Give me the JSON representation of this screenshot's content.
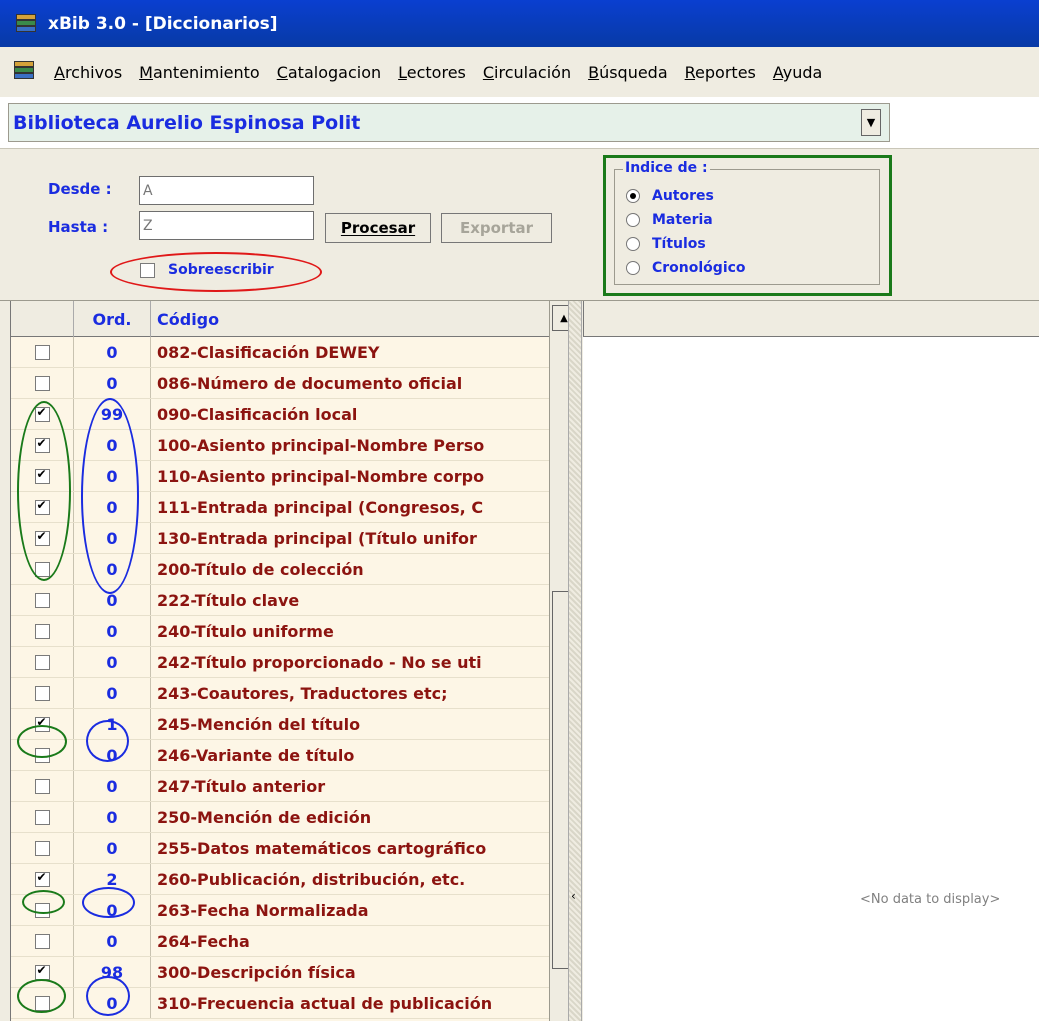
{
  "window": {
    "title": "xBib 3.0 - [Diccionarios]"
  },
  "menu": {
    "items": [
      "Archivos",
      "Mantenimiento",
      "Catalogacion",
      "Lectores",
      "Circulación",
      "Búsqueda",
      "Reportes",
      "Ayuda"
    ]
  },
  "library": {
    "selected": "Biblioteca Aurelio Espinosa Polit"
  },
  "filter": {
    "desde_label": "Desde :",
    "desde_value": "A",
    "hasta_label": "Hasta :",
    "hasta_value": "Z",
    "procesar_label": "Procesar",
    "exportar_label": "Exportar",
    "sobreescribir_label": "Sobreescribir",
    "sobreescribir_checked": false
  },
  "indice": {
    "legend": "Indice de :",
    "options": [
      {
        "label": "Autores",
        "selected": true
      },
      {
        "label": "Materia",
        "selected": false
      },
      {
        "label": "Títulos",
        "selected": false
      },
      {
        "label": "Cronológico",
        "selected": false
      }
    ]
  },
  "grid": {
    "headers": {
      "check": "",
      "ord": "Ord.",
      "codigo": "Código"
    },
    "rows": [
      {
        "checked": false,
        "ord": "0",
        "codigo": "082-Clasificación DEWEY"
      },
      {
        "checked": false,
        "ord": "0",
        "codigo": "086-Número de documento oficial"
      },
      {
        "checked": true,
        "ord": "99",
        "codigo": "090-Clasificación local"
      },
      {
        "checked": true,
        "ord": "0",
        "codigo": "100-Asiento principal-Nombre Perso"
      },
      {
        "checked": true,
        "ord": "0",
        "codigo": "110-Asiento principal-Nombre corpo"
      },
      {
        "checked": true,
        "ord": "0",
        "codigo": "111-Entrada principal (Congresos, C"
      },
      {
        "checked": true,
        "ord": "0",
        "codigo": "130-Entrada principal (Título unifor"
      },
      {
        "checked": false,
        "ord": "0",
        "codigo": "200-Título de colección"
      },
      {
        "checked": false,
        "ord": "0",
        "codigo": "222-Título clave"
      },
      {
        "checked": false,
        "ord": "0",
        "codigo": "240-Título uniforme"
      },
      {
        "checked": false,
        "ord": "0",
        "codigo": "242-Título proporcionado - No se uti"
      },
      {
        "checked": false,
        "ord": "0",
        "codigo": "243-Coautores, Traductores etc;"
      },
      {
        "checked": true,
        "ord": "1",
        "codigo": "245-Mención del título"
      },
      {
        "checked": false,
        "ord": "0",
        "codigo": "246-Variante de título"
      },
      {
        "checked": false,
        "ord": "0",
        "codigo": "247-Título anterior"
      },
      {
        "checked": false,
        "ord": "0",
        "codigo": "250-Mención de edición"
      },
      {
        "checked": false,
        "ord": "0",
        "codigo": "255-Datos matemáticos cartográfico"
      },
      {
        "checked": true,
        "ord": "2",
        "codigo": "260-Publicación, distribución, etc."
      },
      {
        "checked": false,
        "ord": "0",
        "codigo": "263-Fecha Normalizada"
      },
      {
        "checked": false,
        "ord": "0",
        "codigo": "264-Fecha"
      },
      {
        "checked": true,
        "ord": "98",
        "codigo": "300-Descripción física"
      },
      {
        "checked": false,
        "ord": "0",
        "codigo": "310-Frecuencia actual de publicación"
      }
    ],
    "empty_message": "<No data to display>"
  },
  "colors": {
    "annotation_green": "#1a7a1a",
    "annotation_blue": "#1a2ce0",
    "annotation_red": "#e01818"
  }
}
